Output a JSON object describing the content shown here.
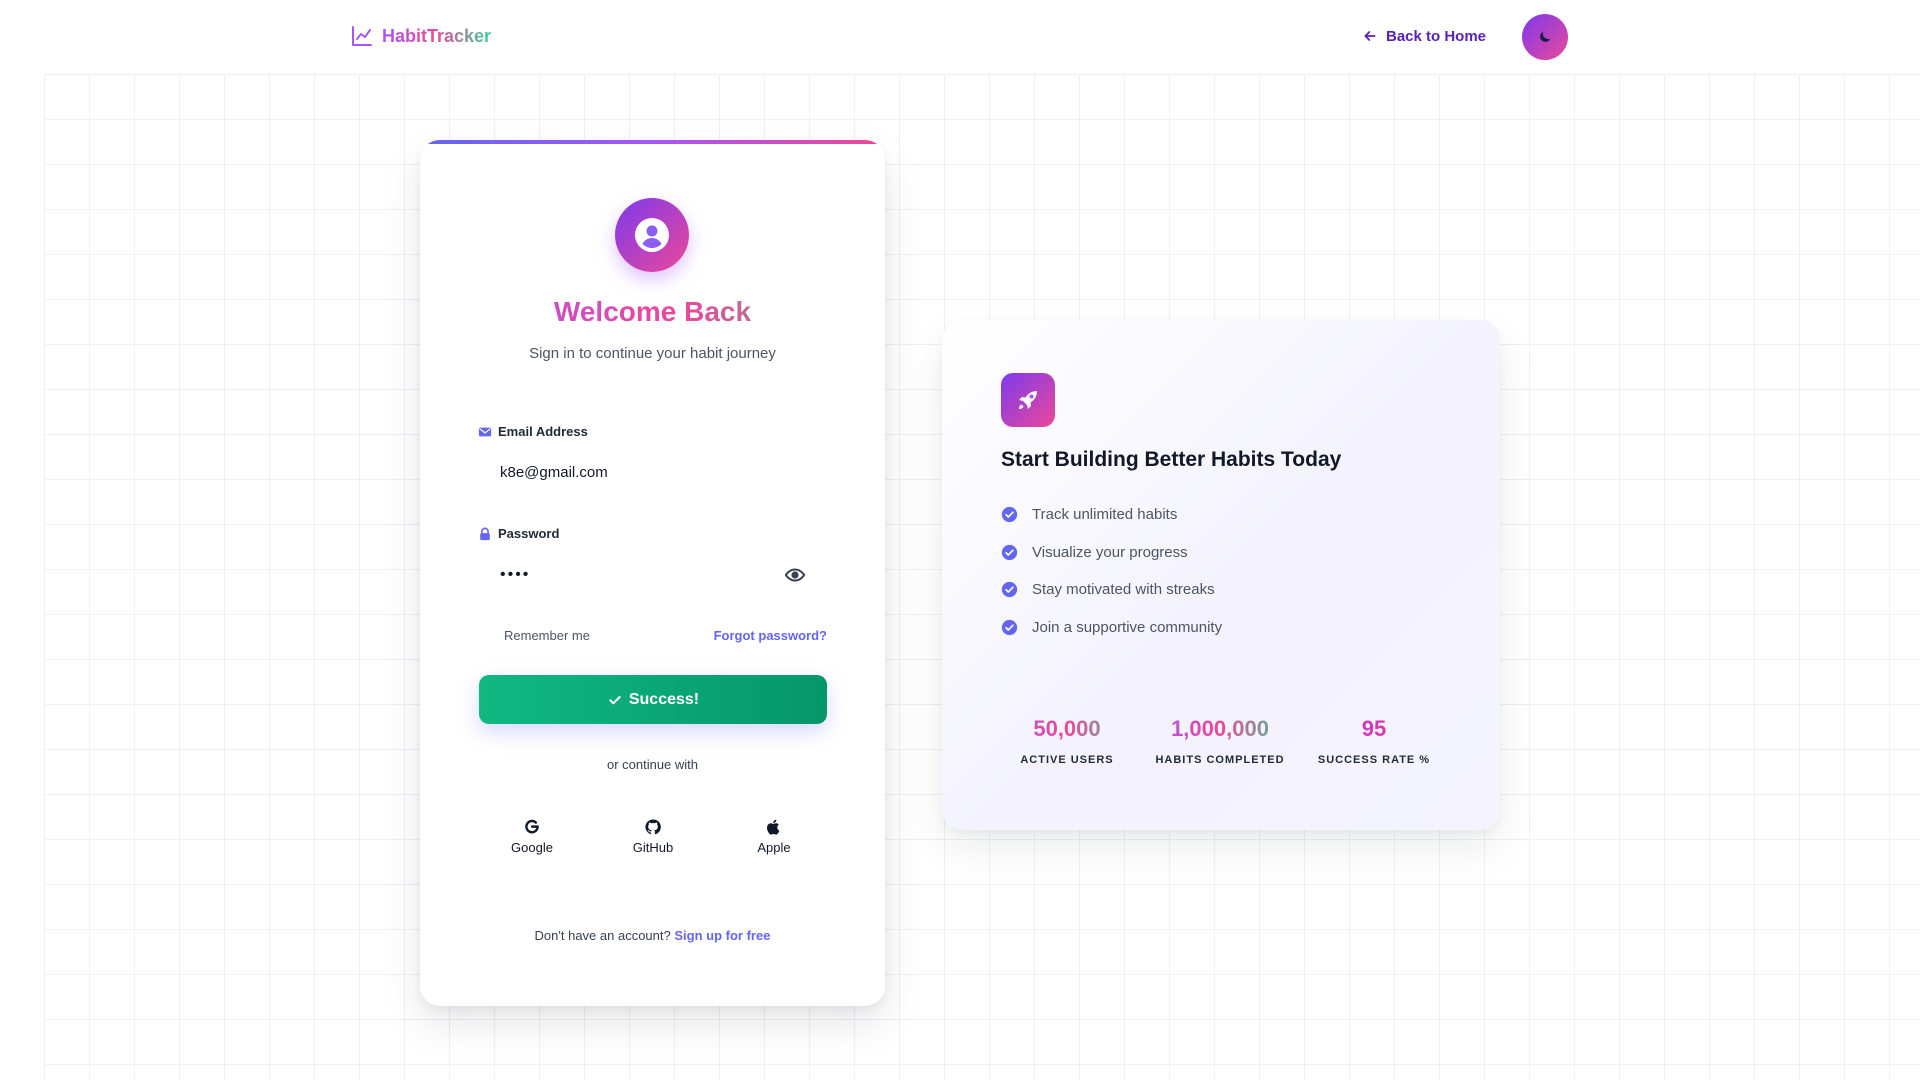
{
  "header": {
    "logo_text": "HabitTracker",
    "logo_icon": "chart-line-icon",
    "back_label": "Back to Home",
    "theme_icon": "moon-icon"
  },
  "login": {
    "title": "Welcome Back",
    "subtitle": "Sign in to continue your habit journey",
    "email_label": "Email Address",
    "email_value": "k8e@gmail.com",
    "password_label": "Password",
    "password_value": "••••",
    "remember_label": "Remember me",
    "forgot_label": "Forgot password?",
    "submit_label": "Success!",
    "divider_text": "or continue with",
    "social": [
      {
        "label": "Google",
        "icon": "google-icon"
      },
      {
        "label": "GitHub",
        "icon": "github-icon"
      },
      {
        "label": "Apple",
        "icon": "apple-icon"
      }
    ],
    "signup_prompt": "Don't have an account?",
    "signup_link": "Sign up for free"
  },
  "info": {
    "title": "Start Building Better Habits Today",
    "features": [
      "Track unlimited habits",
      "Visualize your progress",
      "Stay motivated with streaks",
      "Join a supportive community"
    ],
    "stats": [
      {
        "value": "50,000",
        "label": "ACTIVE USERS"
      },
      {
        "value": "1,000,000",
        "label": "HABITS COMPLETED"
      },
      {
        "value": "95",
        "label": "SUCCESS RATE %"
      }
    ]
  },
  "colors": {
    "accent": "#6366f1",
    "success": "#10b981",
    "gradient_start": "#7c3aed",
    "gradient_end": "#ec4899"
  }
}
